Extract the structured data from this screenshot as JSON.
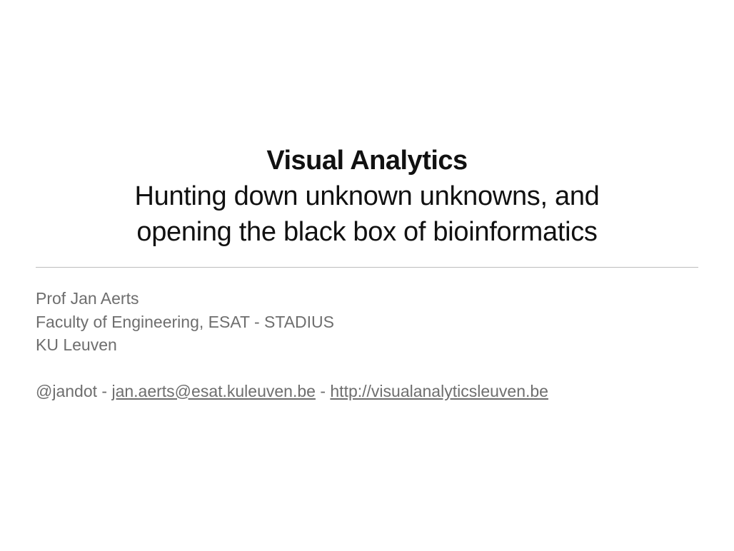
{
  "slide": {
    "title": "Visual Analytics",
    "subtitle_line_1": "Hunting down unknown unknowns, and",
    "subtitle_line_2": "opening the black box of bioinformatics"
  },
  "author": {
    "name": "Prof Jan Aerts",
    "affiliation": "Faculty of Engineering, ESAT - STADIUS",
    "institution": "KU Leuven"
  },
  "contact": {
    "handle": "@jandot",
    "separator_1": " - ",
    "email": "jan.aerts@esat.kuleuven.be",
    "separator_2": " - ",
    "website": "http://visualanalyticsleuven.be"
  },
  "colors": {
    "title_text": "#111111",
    "body_text": "#6e6e6e",
    "divider": "#bdbdbd",
    "background": "#ffffff"
  }
}
